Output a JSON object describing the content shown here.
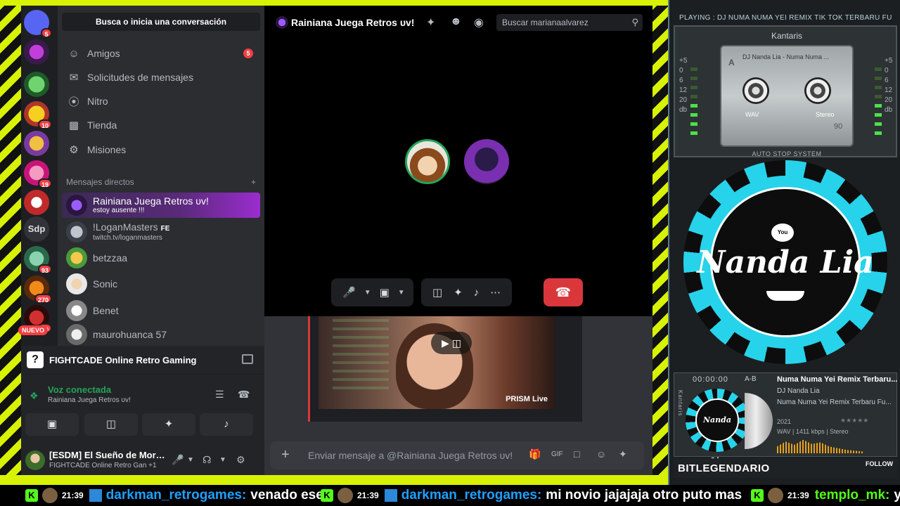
{
  "server_rail": {
    "badges": [
      "5",
      "10",
      "19",
      "93",
      "270",
      "40"
    ],
    "sdp_label": "Sdp",
    "nuevo_label": "NUEVO"
  },
  "dm_sidebar": {
    "search_label": "Busca o inicia una conversación",
    "nav": [
      {
        "label": "Amigos",
        "icon": "friends-icon",
        "count": "5"
      },
      {
        "label": "Solicitudes de mensajes",
        "icon": "mail-icon"
      },
      {
        "label": "Nitro",
        "icon": "nitro-icon"
      },
      {
        "label": "Tienda",
        "icon": "shop-icon"
      },
      {
        "label": "Misiones",
        "icon": "quests-icon"
      }
    ],
    "dm_header": "Mensajes directos",
    "add_dm": "+",
    "dms": [
      {
        "name": "Rainiana Juega Retros υv!",
        "sub": "estoy ausente !!!"
      },
      {
        "name": "!LoganMasters",
        "tag": "FE",
        "sub": "twitch.tv/loganmasters"
      },
      {
        "name": "betzzaa"
      },
      {
        "name": "Sonic"
      },
      {
        "name": "Benet"
      },
      {
        "name": "maurohuanca 57"
      }
    ]
  },
  "activity": {
    "game": "FIGHTCADE Online Retro Gaming",
    "icon_glyph": "?"
  },
  "voice": {
    "status": "Voz conectada",
    "channel": "Rainiana Juega Retros υv!"
  },
  "user": {
    "name": "[ESDM] El Sueño de Mor…",
    "status": "FIGHTCADE Online Retro Gan +1"
  },
  "call": {
    "title": "Rainiana Juega Retros υv!",
    "search_placeholder": "Buscar marianaalvarez",
    "stream_label": "PRISM Live"
  },
  "composer": {
    "placeholder": "Enviar mensaje a @Rainiana Juega Retros υv!"
  },
  "player": {
    "playing": "PLAYING :  DJ NUMA NUMA YEI REMIX TIK TOK TERBARU FU",
    "brand": "Kantaris",
    "cassette_title": "DJ Nanda Lia - Numa Numa ...",
    "cassette_side": "A",
    "cassette_format": "WAV",
    "cassette_mode": "Stereo",
    "cassette_length": "90",
    "autostop": "AUTO STOP SYSTEM",
    "meter_labels": [
      "+5",
      "0",
      "6",
      "12",
      "20",
      "db"
    ],
    "logo_text": "Nanda Lia",
    "logo_badge": "You Tube",
    "time": "00:00:00",
    "ab": "A-B",
    "song": "Numa Numa Yei Remix Terbaru...",
    "artist": "DJ Nanda Lia",
    "album": "Numa Numa Yei Remix Terbaru Fu...",
    "year": "2021",
    "stars": "★★★★★",
    "format": "WAV | 1411 kbps | Stereo",
    "vertical": "Kantaris",
    "channel_name": "BITLEGENDARIO",
    "follow": "FOLLOW"
  },
  "ticker": [
    {
      "time": "21:39",
      "user": "darkman_retrogames:",
      "msg": "venado ese"
    },
    {
      "time": "21:39",
      "user": "darkman_retrogames:",
      "msg": "mi novio jajajaja otro puto mas"
    },
    {
      "time": "21:39",
      "user": "templo_mk:",
      "msg": "y"
    }
  ],
  "colors": {
    "frame_yellow": "#d7f205",
    "discord_bg": "#1e1f22",
    "hangup_red": "#da373c",
    "voice_green": "#23a55a",
    "kick_green": "#53fc18",
    "logo_cyan": "#27d3ea"
  }
}
